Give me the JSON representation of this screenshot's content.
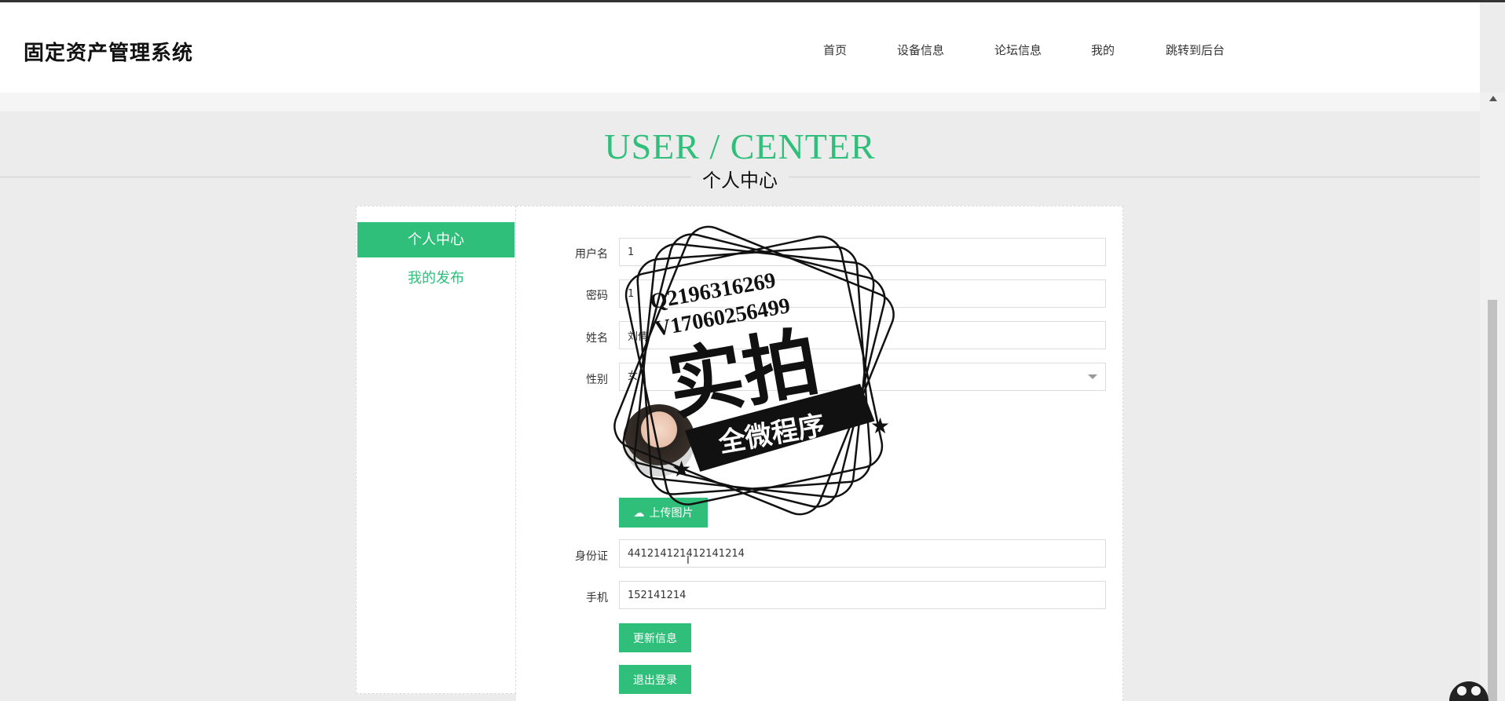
{
  "brand": "固定资产管理系统",
  "nav": {
    "items": [
      {
        "label": "首页"
      },
      {
        "label": "设备信息"
      },
      {
        "label": "论坛信息"
      },
      {
        "label": "我的"
      },
      {
        "label": "跳转到后台"
      }
    ]
  },
  "page_title": {
    "en": "USER / CENTER",
    "zh": "个人中心"
  },
  "sidebar": {
    "items": [
      {
        "label": "个人中心",
        "active": true
      },
      {
        "label": "我的发布",
        "active": false
      }
    ]
  },
  "form": {
    "username": {
      "label": "用户名",
      "value": "1"
    },
    "password": {
      "label": "密码",
      "value": "1"
    },
    "name": {
      "label": "姓名",
      "value": "刘倩"
    },
    "gender": {
      "label": "性别",
      "value": "女"
    },
    "upload_label": "上传图片",
    "idcard": {
      "label": "身份证",
      "value": "441214121412141214"
    },
    "phone": {
      "label": "手机",
      "value": "152141214"
    },
    "update_button": "更新信息",
    "logout_button": "退出登录"
  },
  "watermark": {
    "line1": "Q2196316269",
    "line2": "V17060256499",
    "main": "实拍",
    "ribbon": "全微程序"
  },
  "colors": {
    "accent": "#2fbf7a",
    "background": "#ececec"
  }
}
